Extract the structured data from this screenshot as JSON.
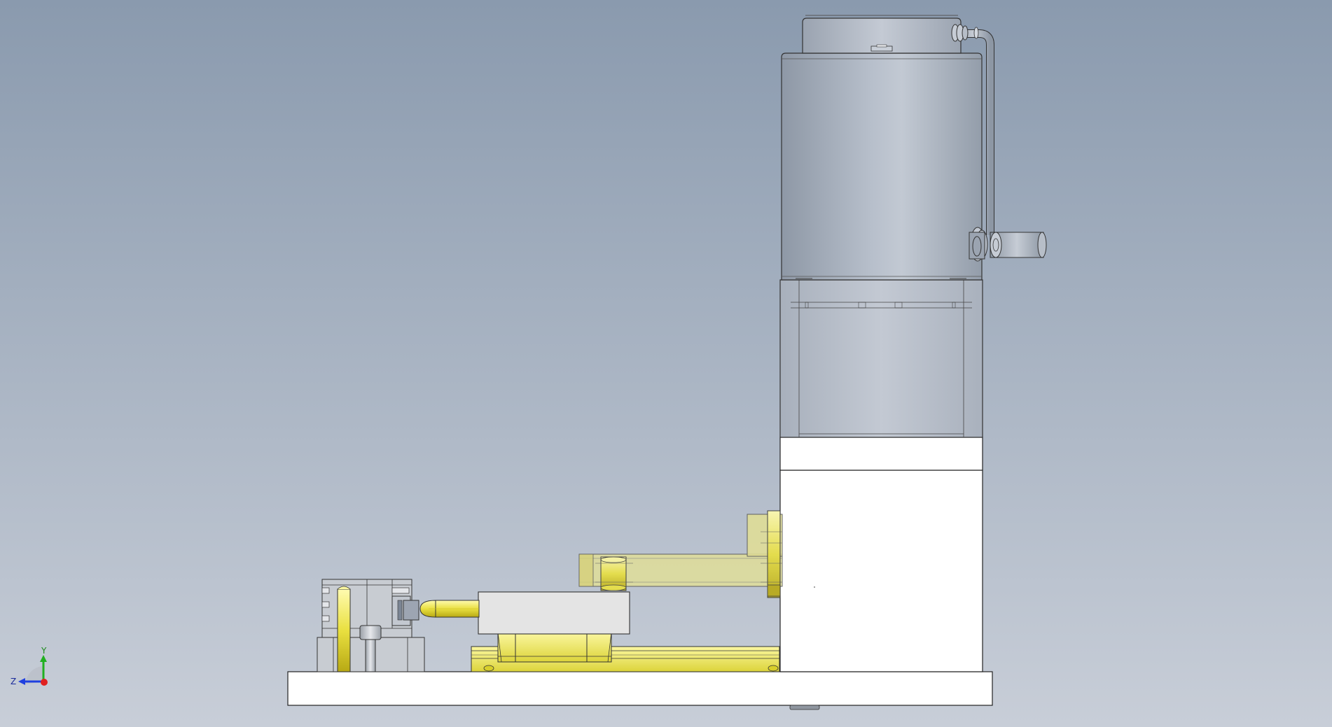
{
  "viewport": {
    "background_top": "#8a9aae",
    "background_bottom": "#c8ced8"
  },
  "colors": {
    "motor_gray": "#b4bcc8",
    "housing_gray": "#bcc3ce",
    "white_part": "#ffffff",
    "yellow_part": "#f1ec6a",
    "yellow_transparent": "#e7e38c",
    "light_gray_block": "#e2e2e2",
    "outline": "#222222",
    "axis_x": "#e02020",
    "axis_y": "#20b020",
    "axis_z": "#2040e0"
  },
  "triad": {
    "y_label": "Y",
    "z_label": "Z"
  }
}
